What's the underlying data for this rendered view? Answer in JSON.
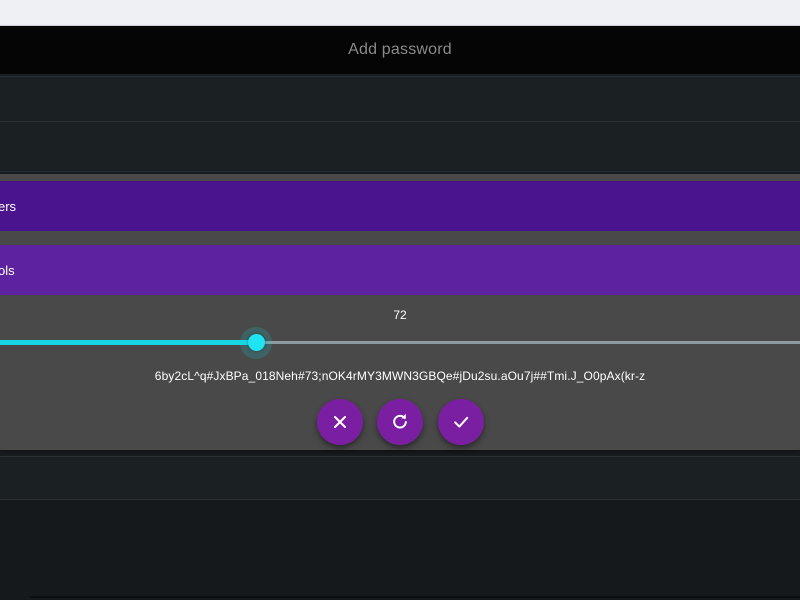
{
  "app": {
    "title": "Add password"
  },
  "options": [
    {
      "label": "ers"
    },
    {
      "label": "ols"
    }
  ],
  "length": {
    "value": "72",
    "fraction": 0.32
  },
  "generated_password": "6by2cL^q#JxBPa_018Neh#73;nOK4rMY3MWN3GBQe#jDu2su.aOu7j##Tmi.J_O0pAx(kr-z",
  "actions": [
    {
      "name": "cancel",
      "icon": "close-icon"
    },
    {
      "name": "regenerate",
      "icon": "refresh-icon"
    },
    {
      "name": "confirm",
      "icon": "check-icon"
    }
  ],
  "colors": {
    "header": "#050505",
    "numbers_bar": "#4b148f",
    "symbols_bar": "#5c229f",
    "slider_accent": "#18d7e5",
    "fab": "#7b1fa2"
  }
}
